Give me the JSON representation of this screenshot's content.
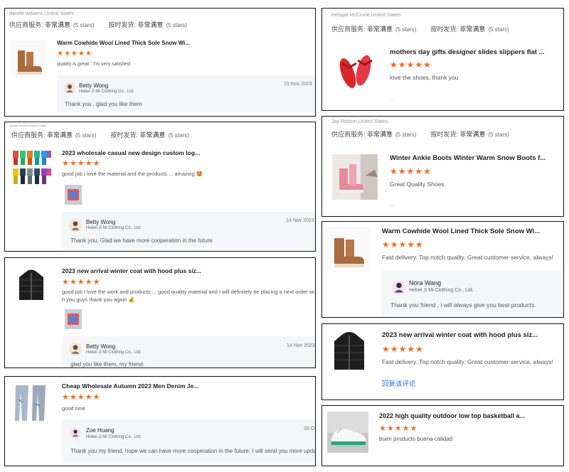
{
  "colors": {
    "star": "#f26b1d",
    "link": "#2b6fd6",
    "reply_bg": "#f5f6f8",
    "border": "#111111"
  },
  "rating_labels": {
    "supplier": "供应商服务:",
    "shipping": "按时发货:",
    "value": "非常满意",
    "stars": "(5 stars)"
  },
  "stars_glyph": "★★★★★",
  "cards": {
    "c1": {
      "reviewer": "darelle williams,United States",
      "product_title": "Warm Cowhide Wool Lined Thick Sole Snow Wi...",
      "comment": "quality is great . I'm very satisfied",
      "reply": {
        "name": "Betty Wong",
        "company": "Hebei Ji Mi Clothing Co., Ltd.",
        "date": "15 Nov 2023",
        "text": "Thank you , glad you like them"
      },
      "icon": "snow-boot-image"
    },
    "c2": {
      "reviewer": "darelle williams,United States",
      "product_title": "2023 wholesale casual new design custom log...",
      "comment": "good job I love the material and the products ... amazing 🤩",
      "reply": {
        "name": "Betty Wong",
        "company": "Hebei Ji Mi Clothing Co., Ltd.",
        "date": "14 Nov 2023",
        "text": "Thank you. Glad we have more cooperation in the future"
      },
      "icon": "tracksuit-set-image"
    },
    "c3": {
      "product_title": "2023 new arrival winter coat with hood plus siz...",
      "comment_line1": "good job I love the work and products ... good quality material and I will definitely be placing a next order wi",
      "comment_line2": "h you guys thank you again 💰",
      "reply": {
        "name": "Betty Wong",
        "company": "Hebei Ji Mi Clothing Co., Ltd.",
        "date": "14 Nov 2023",
        "text": "glad you like them, my friend."
      },
      "icon": "puffer-jacket-image"
    },
    "c4": {
      "product_title": "Cheap Wholesale Autumn 2023 Men Denim Je...",
      "comment": "good time",
      "reply": {
        "name": "Zoe Huang",
        "company": "Hebei Ji Mi Clothing Co., Ltd.",
        "date": "26 O",
        "text": "Thank you my friend, hope we can have more cooperation in the future, I will send you more updates."
      },
      "icon": "denim-jeans-image"
    },
    "c5": {
      "reviewer": "Helygal McCrone,United States",
      "product_title": "mothers day gifts designer slides slippers flat ...",
      "comment": "love the shoes, thank you",
      "icon": "red-sandals-image"
    },
    "c6": {
      "reviewer": "Jay Reborn,United States",
      "product_title": "Winter Ankle Boots Winter Warm Snow Boots f...",
      "comment": "Great Quality Shoes",
      "icon": "pink-boots-image"
    },
    "c7": {
      "product_title": "Warm Cowhide Wool Lined Thick Sole Snow Wi...",
      "comment": "Fast delivery. Top notch quality. Great customer service, always!",
      "reply": {
        "name": "Nora Wang",
        "company": "Hebei Ji Mi Clothing Co., Ltd.",
        "text": "Thank you friend , i will always give you best products."
      },
      "icon": "snow-boot-image"
    },
    "c8": {
      "product_title": "2023 new arrival winter coat with hood plus siz...",
      "comment": "Fast delivery. Top notch quality. Great customer service, always!",
      "reply_link": "回复该评论",
      "icon": "puffer-jacket-image"
    },
    "c9": {
      "product_title": "2022 high quality outdoor low top basketball a...",
      "comment": "buen producto buena calidad",
      "icon": "sneaker-image"
    }
  }
}
